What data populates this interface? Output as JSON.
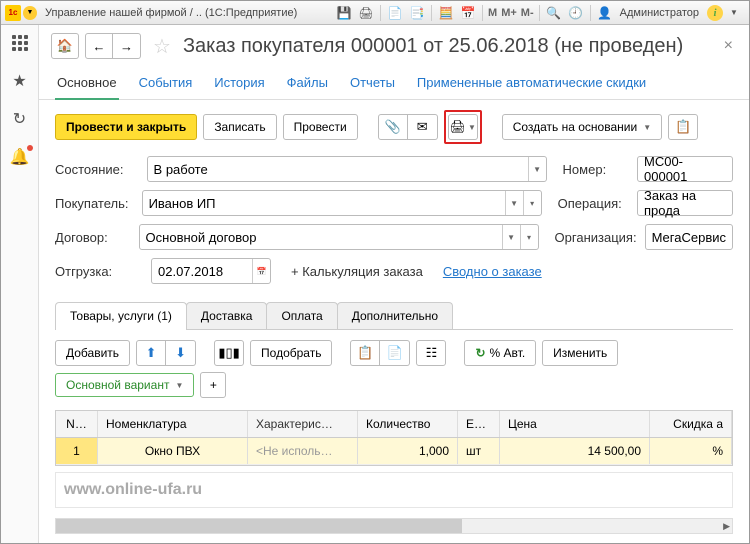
{
  "sysbar": {
    "title": "Управление нашей фирмой / .. (1С:Предприятие)",
    "m": "M",
    "mplus": "M+",
    "mminus": "M-",
    "user": "Администратор"
  },
  "doc": {
    "title": "Заказ покупателя 000001 от 25.06.2018 (не проведен)"
  },
  "tabs": {
    "main": "Основное",
    "events": "События",
    "history": "История",
    "files": "Файлы",
    "reports": "Отчеты",
    "discounts": "Примененные автоматические скидки"
  },
  "toolbar": {
    "post_close": "Провести и закрыть",
    "save": "Записать",
    "post": "Провести",
    "create_based": "Создать на основании"
  },
  "form": {
    "state_label": "Состояние:",
    "state_value": "В работе",
    "number_label": "Номер:",
    "number_value": "МС00-000001",
    "buyer_label": "Покупатель:",
    "buyer_value": "Иванов ИП",
    "operation_label": "Операция:",
    "operation_value": "Заказ на прода",
    "contract_label": "Договор:",
    "contract_value": "Основной договор",
    "org_label": "Организация:",
    "org_value": "МегаСервис",
    "ship_label": "Отгрузка:",
    "ship_value": "02.07.2018",
    "calc": "+ Калькуляция заказа",
    "summary": "Сводно о заказе"
  },
  "subtabs": {
    "goods": "Товары, услуги (1)",
    "delivery": "Доставка",
    "payment": "Оплата",
    "extra": "Дополнительно"
  },
  "subtoolbar": {
    "add": "Добавить",
    "pick": "Подобрать",
    "auto": "% Авт.",
    "change": "Изменить",
    "variant": "Основной вариант"
  },
  "table": {
    "hdr": {
      "n": "N…",
      "nom": "Номенклатура",
      "char": "Характерис…",
      "qty": "Количество",
      "unit": "Е…",
      "price": "Цена",
      "disc": "Скидка а"
    },
    "rows": [
      {
        "n": "1",
        "nom": "Окно ПВХ",
        "char": "<Не исполь…",
        "qty": "1,000",
        "unit": "шт",
        "price": "14 500,00",
        "disc": "%"
      }
    ]
  },
  "watermark": "www.online-ufa.ru",
  "chart_data": {
    "type": "table",
    "title": "Заказ покупателя 000001 от 25.06.2018",
    "columns": [
      "N",
      "Номенклатура",
      "Характеристика",
      "Количество",
      "Ед.",
      "Цена",
      "Скидка"
    ],
    "rows": [
      [
        1,
        "Окно ПВХ",
        "<Не используется>",
        1.0,
        "шт",
        14500.0,
        null
      ]
    ]
  }
}
